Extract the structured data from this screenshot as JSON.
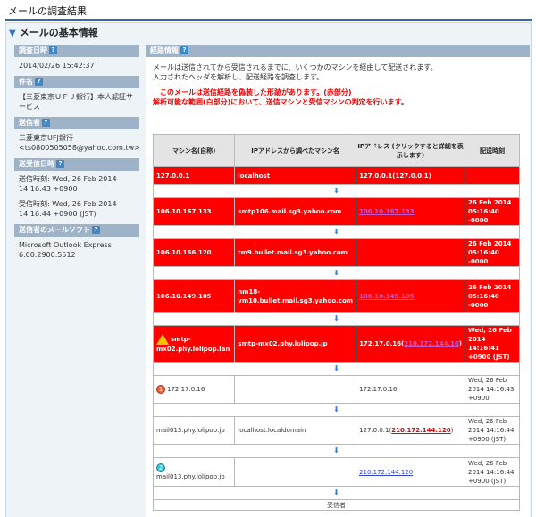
{
  "page": {
    "title": "メールの調査結果",
    "section_title": "メールの基本情報"
  },
  "left": {
    "date_label": "調査日時",
    "date_value": "2014/02/26 15:42:37",
    "subject_label": "件名",
    "subject_value": "【三菱東京ＵＦＪ銀行】本人認証サービス",
    "sender_label": "送信者",
    "sender_name": "三菱東京UFJ銀行",
    "sender_email": "<ts0800505058@yahoo.com.tw>",
    "sendrecv_label": "送受信日時",
    "send_time": "送信時刻: Wed, 26 Feb 2014 14:16:43 +0900",
    "recv_time": "受信時刻: Wed, 26 Feb 2014 14:16:44 +0900 (JST)",
    "software_label": "送信者のメールソフト",
    "software_value": "Microsoft Outlook Express 6.00.2900.5512"
  },
  "route": {
    "label": "経路情報",
    "intro1": "メールは送信されてから受信されるまでに、いくつかのマシンを経由して配送されます。",
    "intro2": "入力されたヘッダを解析し、配送経路を調査します。",
    "warn1": "このメールは送信経路を偽装した形跡があります。(赤部分)",
    "warn2": "解析可能な範囲(白部分)において、送信マシンと受信マシンの判定を行います。",
    "headers": [
      "マシン名(自称)",
      "IPアドレスから調べたマシン名",
      "IPアドレス (クリックすると詳細を表示します)",
      "配送時刻"
    ],
    "arrow": "⬇",
    "r1": {
      "name": "127.0.0.1",
      "host": "localhost",
      "ip": "127.0.0.1(127.0.0.1)",
      "time": ""
    },
    "r2": {
      "name": "106.10.167.133",
      "host": "smtp106.mail.sg3.yahoo.com",
      "ip": "106.10.167.133",
      "time": "26 Feb 2014 05:16:40 -0000"
    },
    "r3": {
      "name": "106.10.166.120",
      "host": "tm9.bullet.mail.sg3.yahoo.com",
      "ip": "",
      "time": "26 Feb 2014 05:16:40 -0000"
    },
    "r4": {
      "name": "106.10.149.105",
      "host": "nm18-vm10.bullet.mail.sg3.yahoo.com",
      "ip": "106.10.149.105",
      "time": "26 Feb 2014 05:16:40 -0000"
    },
    "r5": {
      "name": "smtp-mx02.phy.lolipop.lan",
      "host": "smtp-mx02.phy.lolipop.jp",
      "ip_pre": "172.17.0.16(",
      "ip_link": "210.172.144.16",
      "ip_post": ")",
      "time": "Wed, 26 Feb 2014 14:16:41 +0900 (JST)"
    },
    "r6": {
      "badge": "1",
      "name": "172.17.0.16",
      "host": "",
      "ip": "172.17.0.16",
      "time": "Wed, 26 Feb 2014 14:16:43 +0900"
    },
    "r7": {
      "name": "mail013.phy.lolipop.jp",
      "host": "localhost.localdomain",
      "ip_pre": "127.0.0.1(",
      "ip_link": "210.172.144.120",
      "ip_post": ")",
      "time": "Wed, 26 Feb 2014 14:16:44 +0900 (JST)"
    },
    "r8": {
      "badge": "2",
      "name": "mail013.phy.lolipop.jp",
      "host": "",
      "ip": "210.172.144.120",
      "time": "Wed, 26 Feb 2014 14:16:44 +0900 (JST)"
    },
    "footer": "受信者"
  }
}
